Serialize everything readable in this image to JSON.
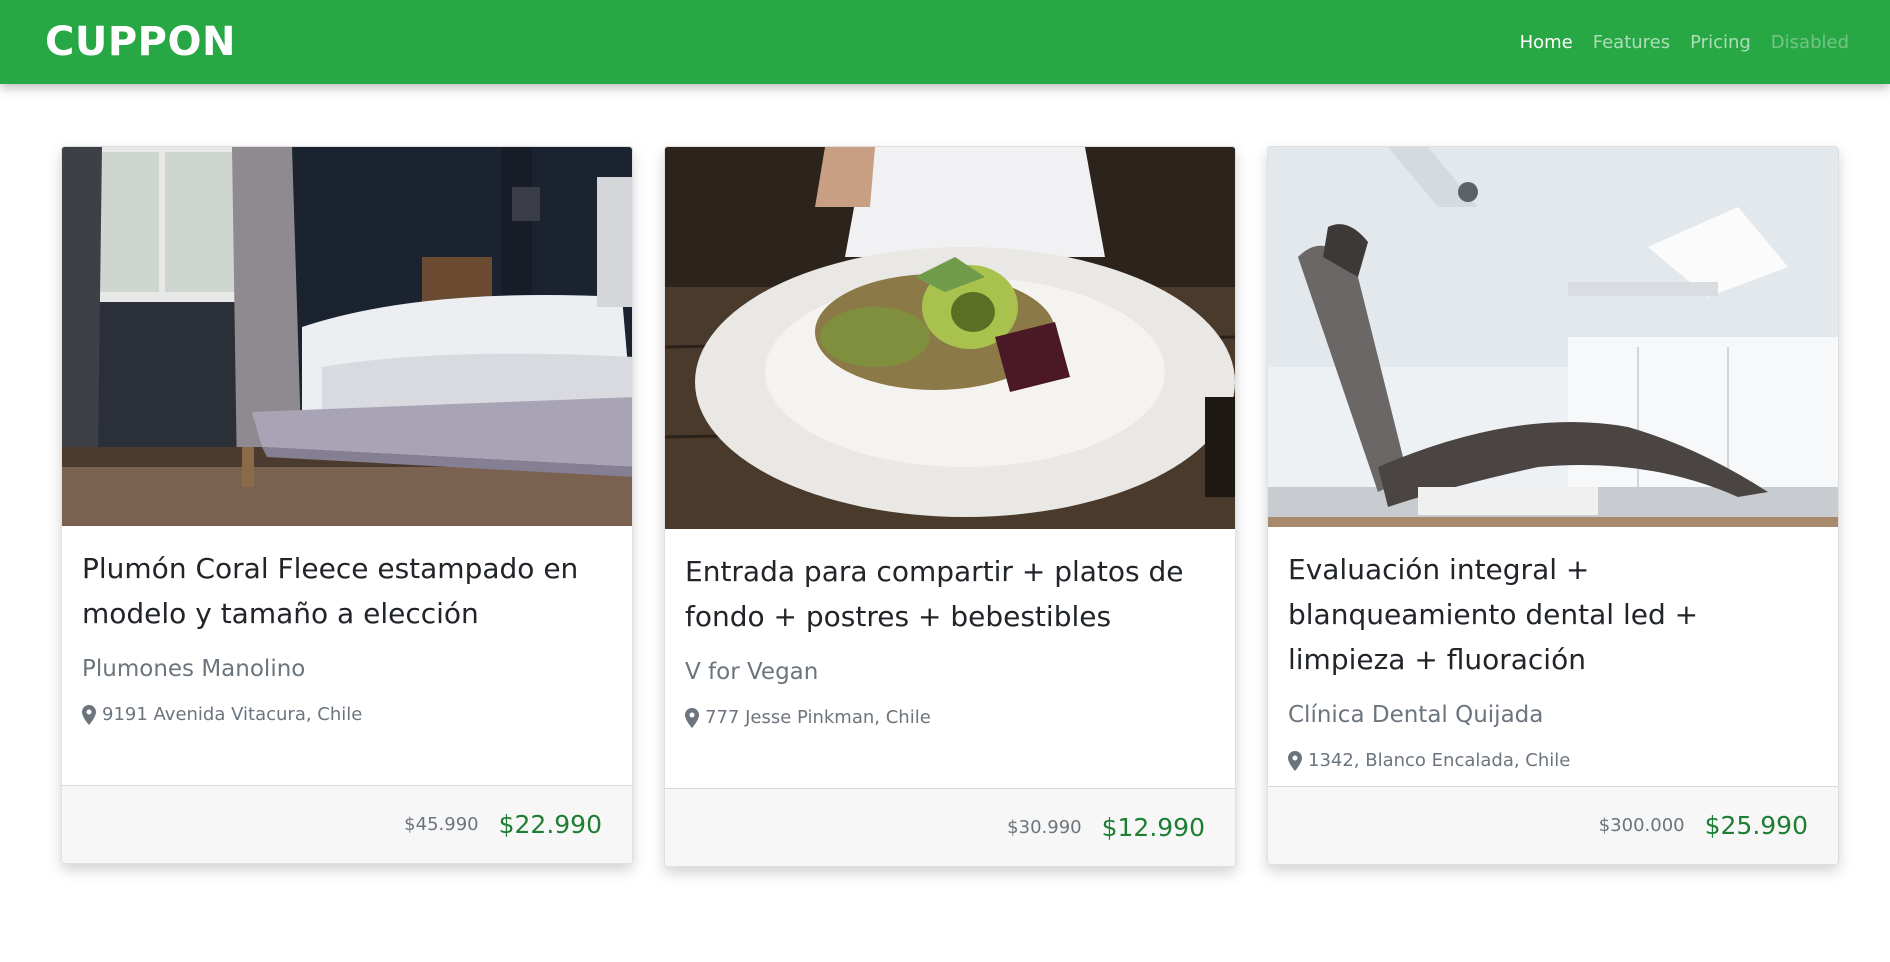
{
  "navbar": {
    "brand": "CUPPON",
    "links": [
      {
        "label": "Home",
        "state": "active"
      },
      {
        "label": "Features",
        "state": "normal"
      },
      {
        "label": "Pricing",
        "state": "normal"
      },
      {
        "label": "Disabled",
        "state": "disabled"
      }
    ]
  },
  "colors": {
    "accent": "#28a745",
    "price": "#1e7e34",
    "muted": "#6c757d"
  },
  "cards": [
    {
      "image": "bed-photo",
      "title": "Plumón Coral Fleece estampado en modelo y tamaño a elección",
      "merchant": "Plumones Manolino",
      "location": "9191 Avenida Vitacura, Chile",
      "old_price": "$45.990",
      "new_price": "$22.990"
    },
    {
      "image": "salad-plate-photo",
      "title": "Entrada para compartir + platos de fondo + postres + bebestibles",
      "merchant": "V for Vegan",
      "location": "777 Jesse Pinkman, Chile",
      "old_price": "$30.990",
      "new_price": "$12.990"
    },
    {
      "image": "dental-chair-photo",
      "title": "Evaluación integral + blanqueamiento dental led + limpieza + fluoración",
      "merchant": "Clínica Dental Quijada",
      "location": "1342, Blanco Encalada, Chile",
      "old_price": "$300.000",
      "new_price": "$25.990"
    }
  ]
}
